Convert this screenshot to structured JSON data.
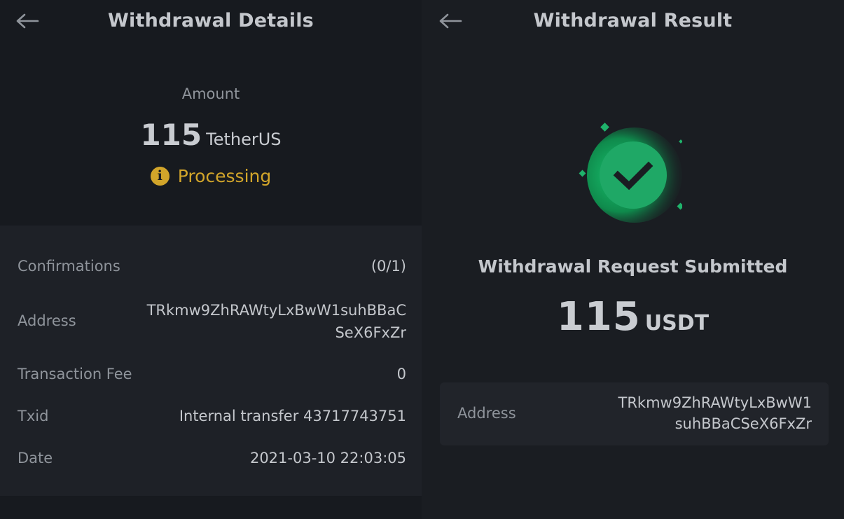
{
  "left": {
    "title": "Withdrawal Details",
    "amount_label": "Amount",
    "amount_value": "115",
    "amount_currency": "TetherUS",
    "status": "Processing",
    "status_icon": "info-icon",
    "status_color": "#d2a52a",
    "rows": {
      "confirmations": {
        "label": "Confirmations",
        "value": "(0/1)"
      },
      "address": {
        "label": "Address",
        "line1": "TRkmw9ZhRAWtyLxBwW1suhBBaC",
        "line2": "SeX6FxZr"
      },
      "fee": {
        "label": "Transaction Fee",
        "value": "0"
      },
      "txid": {
        "label": "Txid",
        "value": "Internal transfer 43717743751"
      },
      "date": {
        "label": "Date",
        "value": "2021-03-10 22:03:05"
      }
    }
  },
  "right": {
    "title": "Withdrawal Result",
    "success_icon": "check-circle-icon",
    "success_color": "#1fa866",
    "message": "Withdrawal Request Submitted",
    "amount_value": "115",
    "amount_currency": "USDT",
    "address": {
      "label": "Address",
      "line1": "TRkmw9ZhRAWtyLxBwW1",
      "line2": "suhBBaCSeX6FxZr"
    }
  },
  "back_icon": "arrow-left-icon"
}
